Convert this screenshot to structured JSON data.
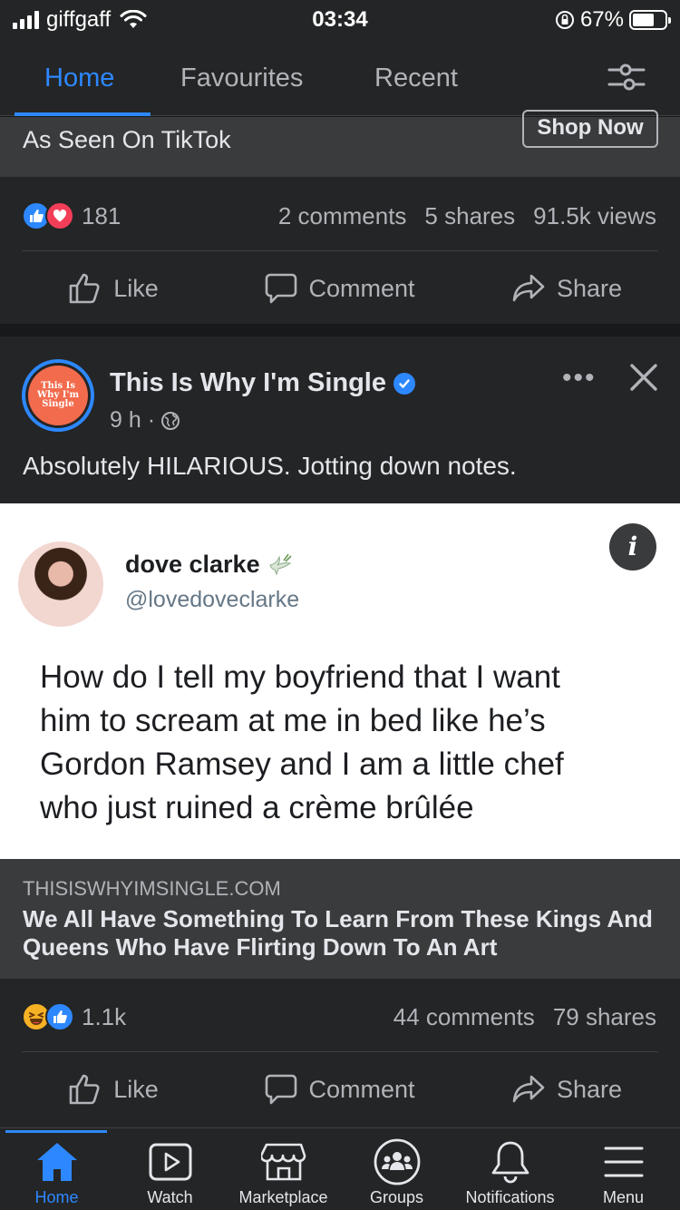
{
  "status_bar": {
    "carrier": "giffgaff",
    "time": "03:34",
    "battery": "67%"
  },
  "tabs": [
    {
      "label": "Home",
      "active": true
    },
    {
      "label": "Favourites",
      "active": false
    },
    {
      "label": "Recent",
      "active": false
    }
  ],
  "prev_post": {
    "ad_title": "As Seen On TikTok",
    "cta": "Shop Now",
    "reaction_count": "181",
    "comments": "2 comments",
    "shares": "5 shares",
    "views": "91.5k views"
  },
  "actions": {
    "like": "Like",
    "comment": "Comment",
    "share": "Share"
  },
  "post": {
    "page_name": "This Is Why I'm Single",
    "avatar_text": [
      "This Is",
      "Why I'm",
      "Single"
    ],
    "time": "9 h ·",
    "text": "Absolutely HILARIOUS. Jotting down notes.",
    "tweet": {
      "name": "dove clarke",
      "handle": "@lovedoveclarke",
      "lines": [
        "How do I tell my boyfriend that I want",
        "him to scream at me in bed like he’s",
        "Gordon Ramsey and I am a little chef",
        "who just ruined a crème brûlée"
      ]
    },
    "link_domain": "THISISWHYIMSINGLE.COM",
    "link_title": "We All Have Something To Learn From These Kings And Queens Who Have Flirting Down To An Art",
    "reaction_count": "1.1k",
    "comments": "44 comments",
    "shares": "79 shares"
  },
  "bottom_nav": [
    {
      "label": "Home",
      "icon": "home-icon",
      "active": true
    },
    {
      "label": "Watch",
      "icon": "watch-icon",
      "active": false
    },
    {
      "label": "Marketplace",
      "icon": "marketplace-icon",
      "active": false
    },
    {
      "label": "Groups",
      "icon": "groups-icon",
      "active": false
    },
    {
      "label": "Notifications",
      "icon": "bell-icon",
      "active": false
    },
    {
      "label": "Menu",
      "icon": "menu-icon",
      "active": false
    }
  ],
  "colors": {
    "accent": "#2d88ff",
    "background": "#18191a",
    "card": "#242526"
  }
}
